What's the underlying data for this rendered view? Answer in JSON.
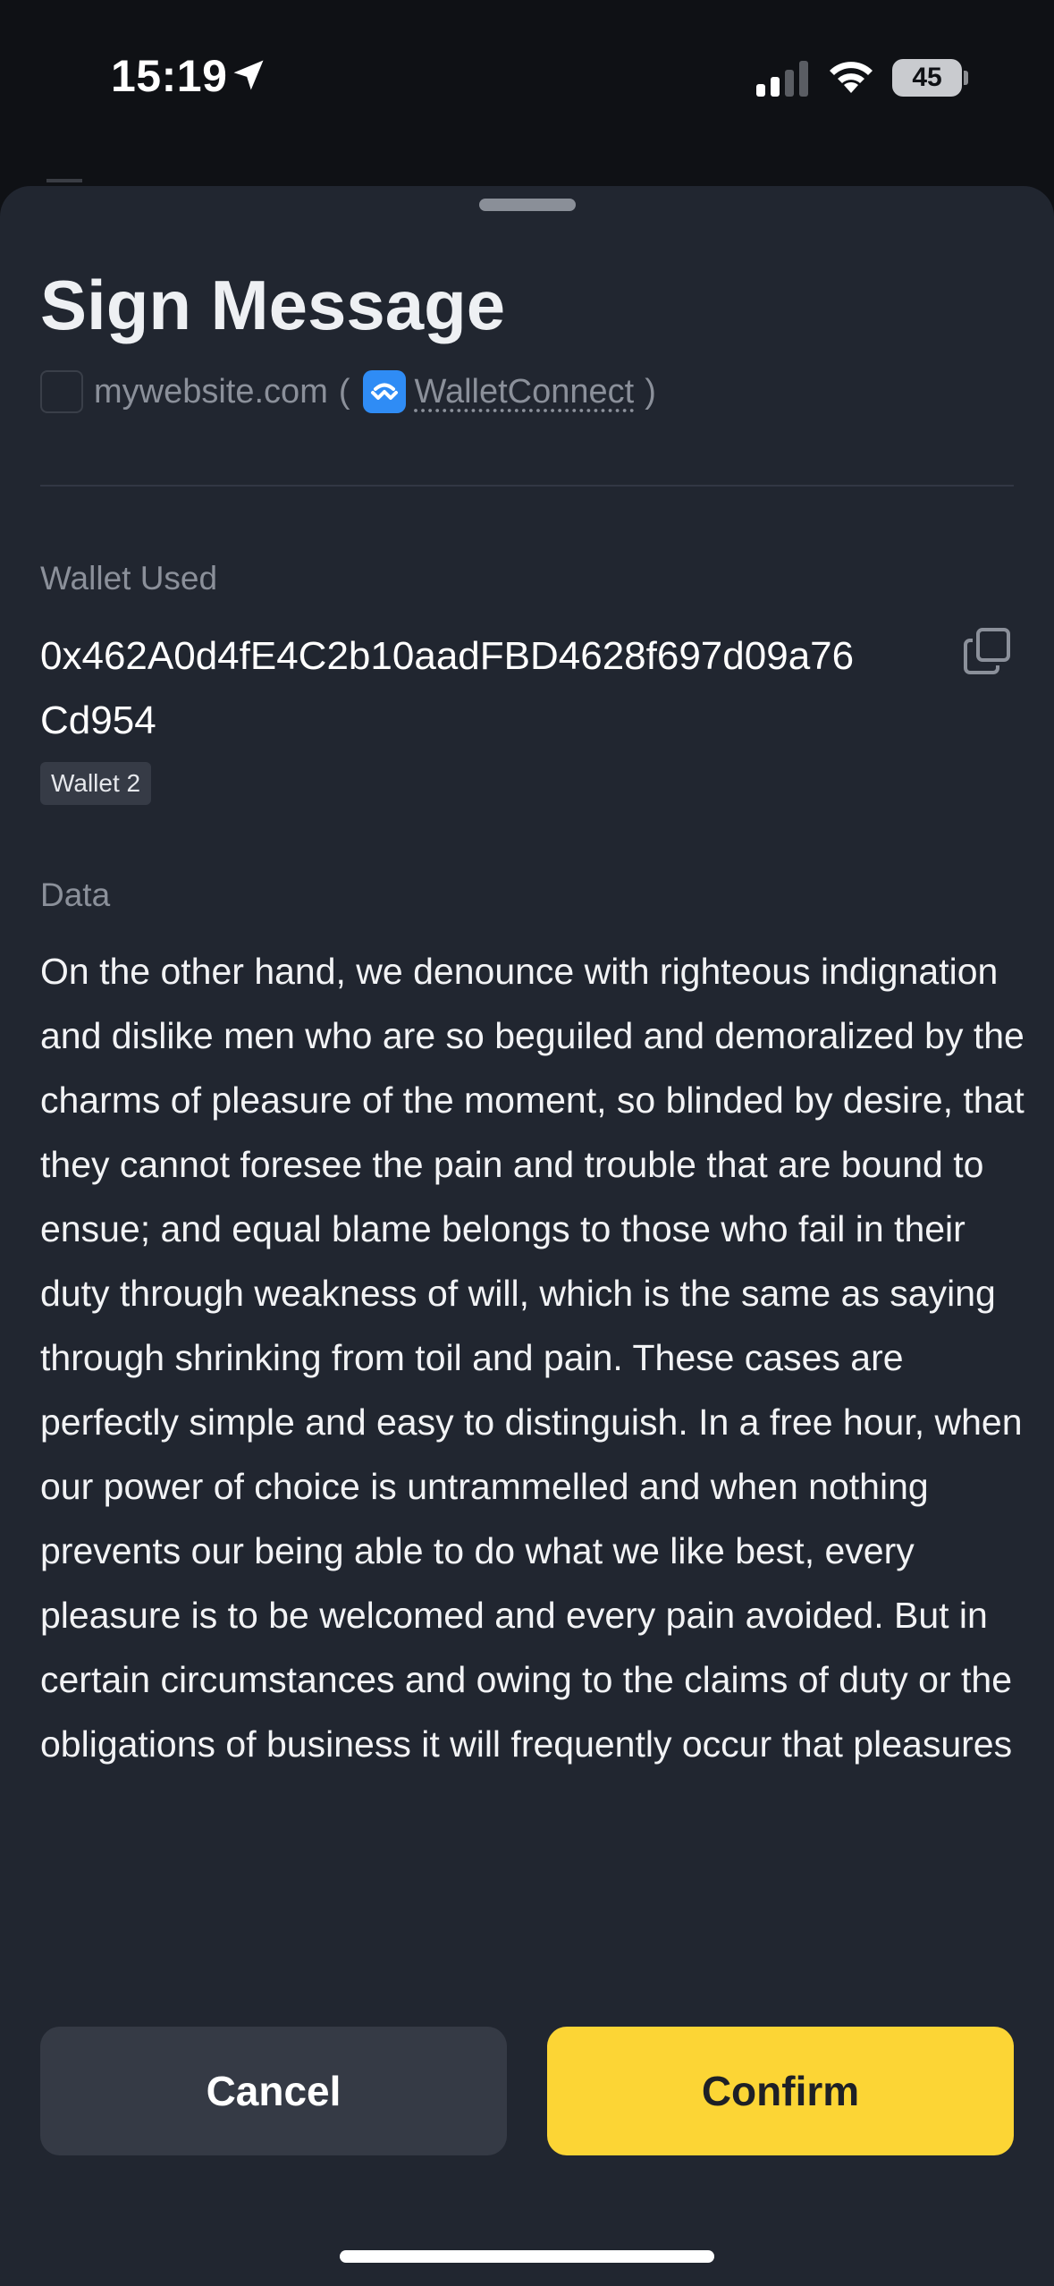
{
  "status_bar": {
    "time": "15:19",
    "battery": "45",
    "icons": [
      "location-arrow-icon",
      "signal-icon",
      "wifi-icon",
      "battery-icon"
    ]
  },
  "sheet": {
    "title": "Sign Message",
    "origin": {
      "site": "mywebsite.com",
      "open_paren": "(",
      "connector": "WalletConnect",
      "close_paren": ")"
    },
    "wallet_used_label": "Wallet Used",
    "wallet_address": "0x462A0d4fE4C2b10aadFBD4628f697d09a76Cd954",
    "wallet_name": "Wallet 2",
    "data_label": "Data",
    "data_text": "On the other hand, we denounce with righteous indignation and dislike men who are so beguiled and demoralized by the charms of pleasure of the moment, so blinded by desire, that they cannot foresee the pain and trouble that are bound to ensue; and equal blame belongs to those who fail in their duty through weakness of will, which is the same as saying through shrinking from toil and pain. These cases are perfectly simple and easy to distinguish. In a free hour, when our power of choice is untrammelled and when nothing prevents our being able to do what we like best, every pleasure is to be welcomed and every pain avoided. But in certain circumstances and owing to the claims of duty or the obligations of business it will frequently occur that pleasures"
  },
  "actions": {
    "cancel_label": "Cancel",
    "confirm_label": "Confirm"
  },
  "colors": {
    "sheet_bg": "#212630",
    "confirm_bg": "#fcd535",
    "cancel_bg": "#353a45",
    "walletconnect_blue": "#2f8cf5"
  }
}
